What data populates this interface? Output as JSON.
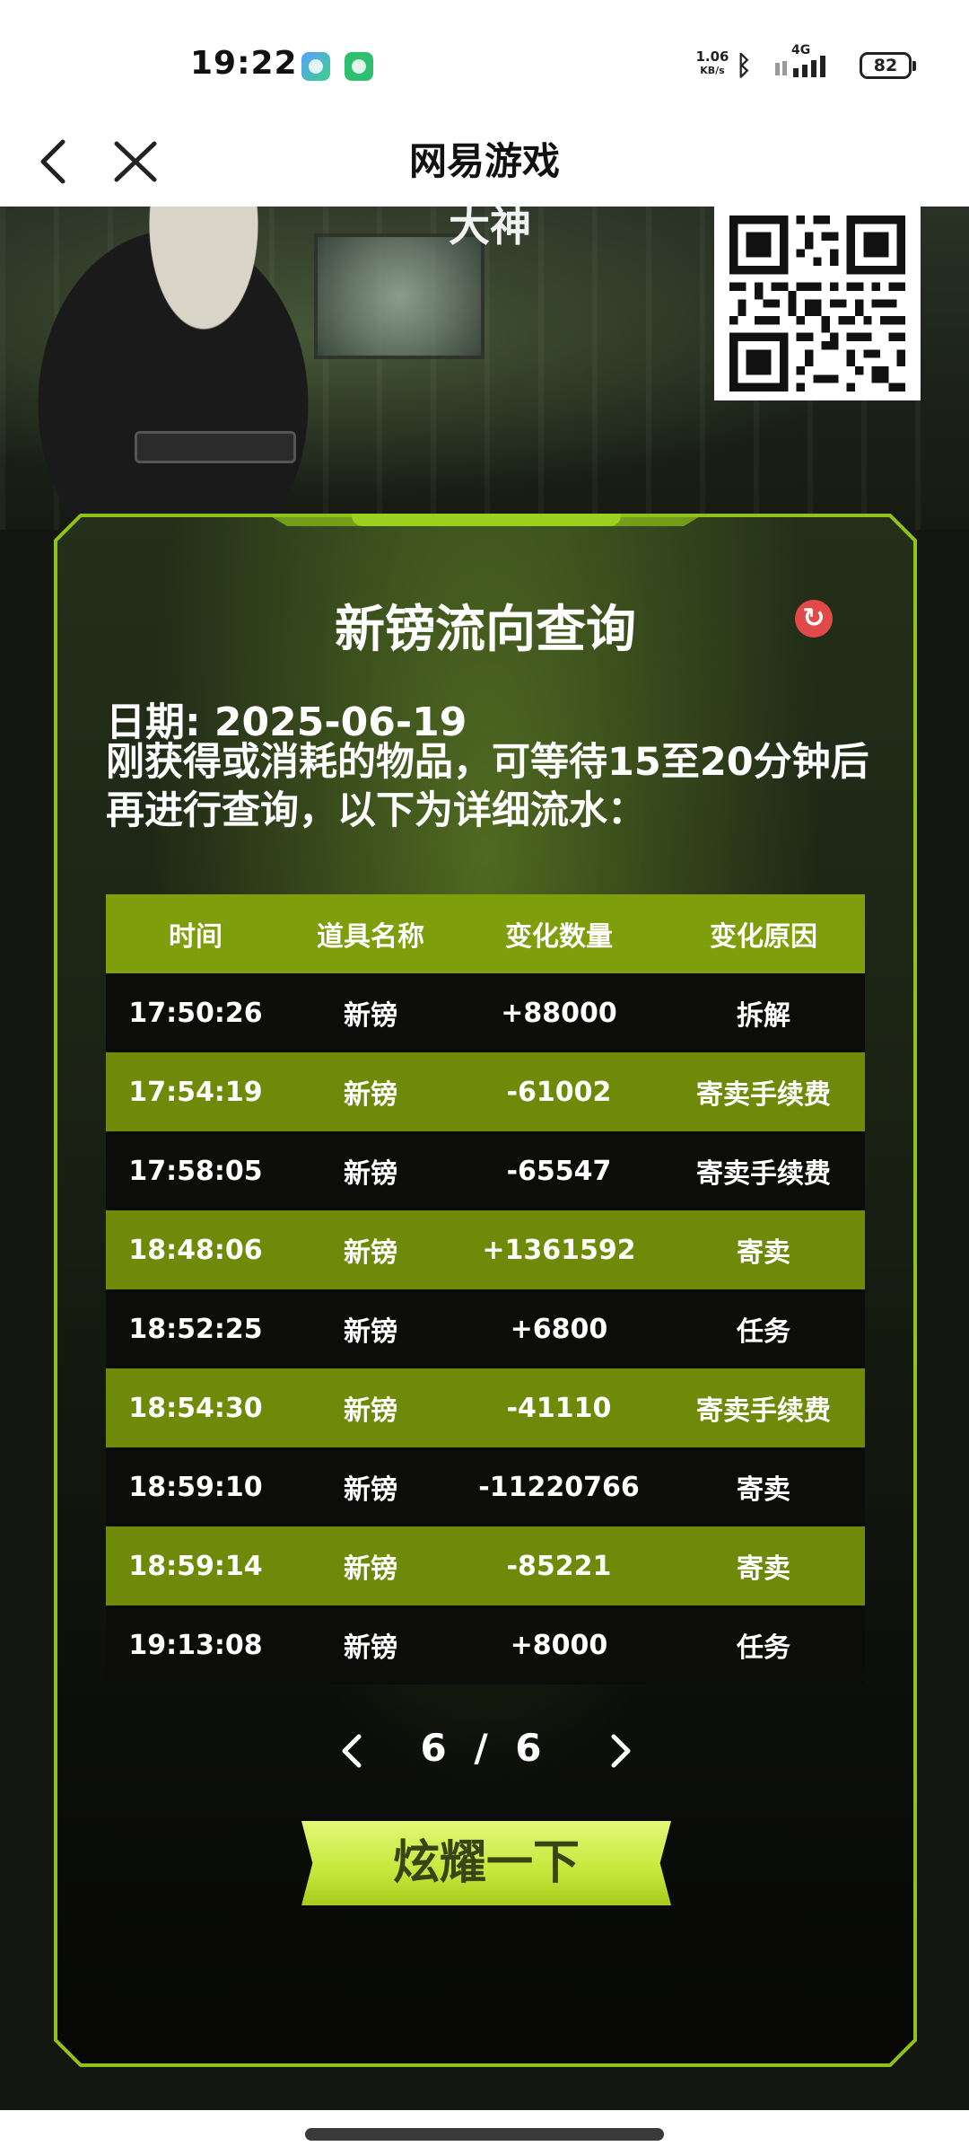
{
  "status_bar": {
    "time": "19:22",
    "net_speed_value": "1.06",
    "net_speed_unit": "KB/s",
    "network": "4G",
    "battery": "82"
  },
  "nav": {
    "title": "网易游戏"
  },
  "banner": {
    "caption": "大神"
  },
  "panel": {
    "title": "新镑流向查询",
    "date_line": "日期: 2025-06-19",
    "note": "刚获得或消耗的物品，可等待15至20分钟后再进行查询，以下为详细流水："
  },
  "ledger": {
    "headers": [
      "时间",
      "道具名称",
      "变化数量",
      "变化原因"
    ],
    "rows": [
      [
        "17:50:26",
        "新镑",
        "+88000",
        "拆解"
      ],
      [
        "17:54:19",
        "新镑",
        "-61002",
        "寄卖手续费"
      ],
      [
        "17:58:05",
        "新镑",
        "-65547",
        "寄卖手续费"
      ],
      [
        "18:48:06",
        "新镑",
        "+1361592",
        "寄卖"
      ],
      [
        "18:52:25",
        "新镑",
        "+6800",
        "任务"
      ],
      [
        "18:54:30",
        "新镑",
        "-41110",
        "寄卖手续费"
      ],
      [
        "18:59:10",
        "新镑",
        "-11220766",
        "寄卖"
      ],
      [
        "18:59:14",
        "新镑",
        "-85221",
        "寄卖"
      ],
      [
        "19:13:08",
        "新镑",
        "+8000",
        "任务"
      ]
    ]
  },
  "pagination": {
    "label": "6 / 6"
  },
  "share_button": {
    "label": "炫耀一下"
  },
  "colors": {
    "accent": "#9bd01f",
    "row_green": "#6f8a08",
    "header_green": "#7f9e0b",
    "row_dark": "#0c0d0b",
    "refresh_red": "#e24a4a"
  }
}
